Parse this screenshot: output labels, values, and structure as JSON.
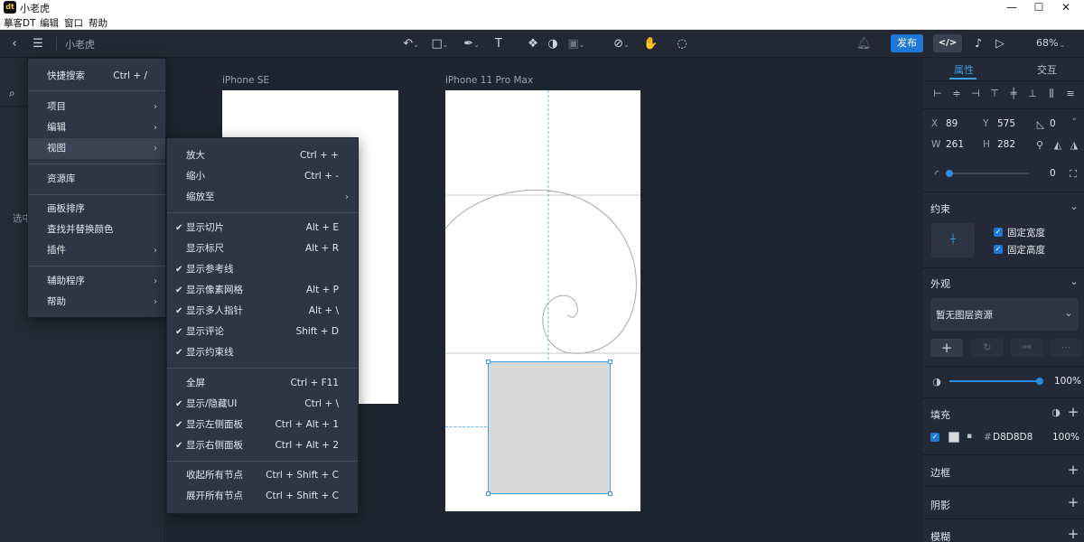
{
  "window": {
    "logo": "dt",
    "title": "小老虎",
    "controls": {
      "minimize": "—",
      "maximize": "☐",
      "close": "✕"
    }
  },
  "menubar": [
    "摹客DT",
    "编辑",
    "窗口",
    "帮助"
  ],
  "toolbar": {
    "doc_name": "小老虎",
    "publish": "发布",
    "code": "</>",
    "zoom": "68%"
  },
  "left_panel": {
    "hint": "选中"
  },
  "main_menu": {
    "items": [
      {
        "label": "快捷搜索",
        "shortcut": "Ctrl + /"
      },
      {
        "label": "项目",
        "arrow": "›"
      },
      {
        "label": "编辑",
        "arrow": "›"
      },
      {
        "label": "视图",
        "arrow": "›"
      },
      {
        "label": "资源库"
      },
      {
        "label": "画板排序"
      },
      {
        "label": "查找并替换颜色"
      },
      {
        "label": "插件",
        "arrow": "›"
      },
      {
        "label": "辅助程序",
        "arrow": "›"
      },
      {
        "label": "帮助",
        "arrow": "›"
      }
    ]
  },
  "view_menu": {
    "items": [
      {
        "label": "放大",
        "shortcut": "Ctrl + +"
      },
      {
        "label": "缩小",
        "shortcut": "Ctrl + -"
      },
      {
        "label": "缩放至",
        "arrow": "›"
      },
      {
        "label": "显示切片",
        "shortcut": "Alt + E",
        "checked": true
      },
      {
        "label": "显示标尺",
        "shortcut": "Alt + R",
        "checked": false
      },
      {
        "label": "显示参考线",
        "checked": true
      },
      {
        "label": "显示像素网格",
        "shortcut": "Alt + P",
        "checked": true
      },
      {
        "label": "显示多人指针",
        "shortcut": "Alt + \\",
        "checked": true
      },
      {
        "label": "显示评论",
        "shortcut": "Shift + D",
        "checked": true
      },
      {
        "label": "显示约束线",
        "checked": true
      },
      {
        "label": "全屏",
        "shortcut": "Ctrl + F11"
      },
      {
        "label": "显示/隐藏UI",
        "shortcut": "Ctrl + \\",
        "checked": true
      },
      {
        "label": "显示左侧面板",
        "shortcut": "Ctrl + Alt + 1",
        "checked": true
      },
      {
        "label": "显示右侧面板",
        "shortcut": "Ctrl + Alt + 2",
        "checked": true
      },
      {
        "label": "收起所有节点",
        "shortcut": "Ctrl + Shift + C"
      },
      {
        "label": "展开所有节点",
        "shortcut": "Ctrl + Shift + C"
      }
    ]
  },
  "canvas": {
    "artboards": [
      {
        "label": "iPhone SE"
      },
      {
        "label": "iPhone 11 Pro Max"
      }
    ],
    "selection_fill": "#D8D8D8",
    "accent": "#3ba0e6"
  },
  "right_panel": {
    "tabs": {
      "properties": "属性",
      "interaction": "交互"
    },
    "x": {
      "label": "X",
      "value": "89"
    },
    "y": {
      "label": "Y",
      "value": "575"
    },
    "rotation": "0",
    "w": {
      "label": "W",
      "value": "261"
    },
    "h": {
      "label": "H",
      "value": "282"
    },
    "radius": "0",
    "constraints": {
      "title": "约束",
      "fix_width": "固定宽度",
      "fix_height": "固定高度"
    },
    "appearance": {
      "title": "外观",
      "style_select": "暂无图层资源"
    },
    "opacity": {
      "value": "100%",
      "fraction": 1.0
    },
    "fill": {
      "title": "填充",
      "hash": "#",
      "hex": "D8D8D8",
      "opacity": "100%"
    },
    "border": "边框",
    "shadow": "阴影",
    "blur": "模糊"
  }
}
